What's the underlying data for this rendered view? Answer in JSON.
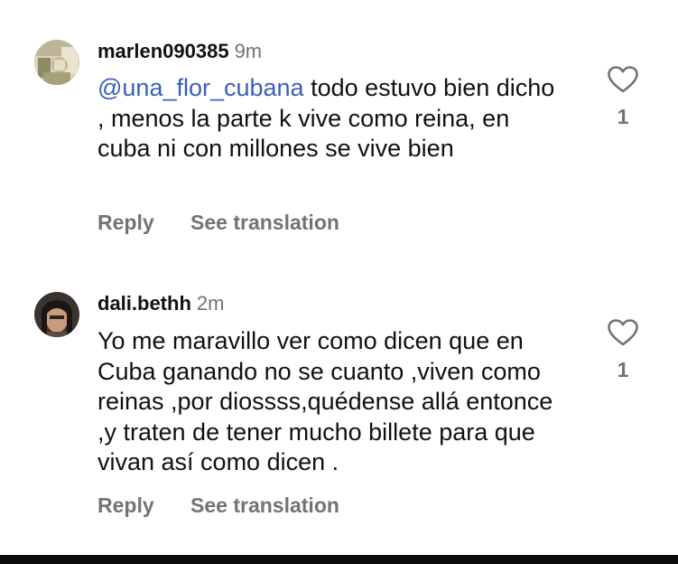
{
  "comments": [
    {
      "username": "marlen090385",
      "time": "9m",
      "mention": "@una_flor_cubana",
      "text": " todo estuvo bien dicho , menos la parte k vive como reina, en cuba ni con millones se vive bien",
      "reply_label": "Reply",
      "translate_label": "See translation",
      "likes": "1",
      "avatar_icon": "profile-photo-icon",
      "like_icon": "heart-outline-icon"
    },
    {
      "username": "dali.bethh",
      "time": "2m",
      "text": "Yo me maravillo ver como dicen que en Cuba ganando no se cuanto ,viven como reinas ,por diossss,quédense allá entonce ,y traten de tener mucho billete para que vivan así como dicen .",
      "reply_label": "Reply",
      "translate_label": "See translation",
      "likes": "1",
      "avatar_icon": "profile-photo-icon",
      "like_icon": "heart-outline-icon"
    }
  ],
  "colors": {
    "background": "#ffffff",
    "text": "#111111",
    "secondary_text": "#737373",
    "mention": "#3a5fb5"
  }
}
